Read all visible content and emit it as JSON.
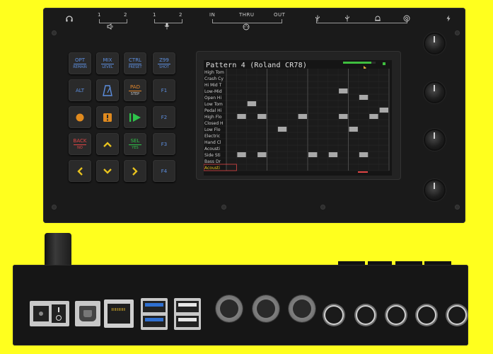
{
  "device": {
    "top_panel": {
      "labels": {
        "headphone_ch1": "1",
        "headphone_ch2": "2",
        "mic_ch1": "1",
        "mic_ch2": "2",
        "midi_in": "IN",
        "midi_thru": "THRU",
        "midi_out": "OUT"
      }
    },
    "keys": [
      {
        "id": "opt",
        "line1": "OPT",
        "line2": "REMAIN",
        "line1_color": "#5d8fe0",
        "line2_color": "#5d8fe0"
      },
      {
        "id": "mix",
        "line1": "MIX",
        "line2": "LEVEL",
        "line1_color": "#5d8fe0",
        "line2_color": "#5d8fe0"
      },
      {
        "id": "ctrl",
        "line1": "CTRL",
        "line2": "PRESET",
        "line1_color": "#5d8fe0",
        "line2_color": "#5d8fe0"
      },
      {
        "id": "zoom",
        "line1": "Z99",
        "line2": "SHOT",
        "line1_color": "#5d8fe0",
        "line2_color": "#5d8fe0"
      },
      {
        "id": "alt",
        "line1": "ALT",
        "line2": "",
        "line1_color": "#5d8fe0",
        "line2_color": "#5d8fe0"
      },
      {
        "id": "metronome",
        "line1": "",
        "line2": "",
        "line1_color": "#5d8fe0",
        "line2_color": "#5d8fe0"
      },
      {
        "id": "pad",
        "line1": "PAD",
        "line2": "STEP",
        "line1_color": "#e0862c",
        "line2_color": "#cccccc"
      },
      {
        "id": "f1",
        "line1": "F1",
        "line2": "",
        "line1_color": "#5d8fe0",
        "line2_color": "#5d8fe0"
      },
      {
        "id": "record",
        "line1": "",
        "line2": "",
        "line1_color": "#e08a1e",
        "line2_color": "#5d8fe0"
      },
      {
        "id": "stop",
        "line1": "",
        "line2": "",
        "line1_color": "#e08a1e",
        "line2_color": "#5d8fe0"
      },
      {
        "id": "play",
        "line1": "",
        "line2": "",
        "line1_color": "#2ec44a",
        "line2_color": "#5d8fe0"
      },
      {
        "id": "f2",
        "line1": "F2",
        "line2": "",
        "line1_color": "#5d8fe0",
        "line2_color": "#5d8fe0"
      },
      {
        "id": "back",
        "line1": "BACK",
        "line2": "NO",
        "line1_color": "#e04545",
        "line2_color": "#e04545"
      },
      {
        "id": "up",
        "line1": "",
        "line2": "",
        "line1_color": "#e8c21e",
        "line2_color": "#5d8fe0"
      },
      {
        "id": "sel",
        "line1": "SEL",
        "line2": "YES",
        "line1_color": "#2ec44a",
        "line2_color": "#2ec44a"
      },
      {
        "id": "f3",
        "line1": "F3",
        "line2": "",
        "line1_color": "#5d8fe0",
        "line2_color": "#5d8fe0"
      },
      {
        "id": "left",
        "line1": "",
        "line2": "",
        "line1_color": "#e8c21e",
        "line2_color": "#5d8fe0"
      },
      {
        "id": "down",
        "line1": "",
        "line2": "",
        "line1_color": "#e8c21e",
        "line2_color": "#5d8fe0"
      },
      {
        "id": "right",
        "line1": "",
        "line2": "",
        "line1_color": "#e8c21e",
        "line2_color": "#5d8fe0"
      },
      {
        "id": "f4",
        "line1": "F4",
        "line2": "",
        "line1_color": "#5d8fe0",
        "line2_color": "#5d8fe0"
      }
    ],
    "screen": {
      "title": "Pattern 4 (Roland CR78)",
      "tracks": [
        "High Tom",
        "Crash Cy",
        "Hi Mid T",
        "Low-Mid",
        "Open Hi",
        "Low Tom",
        "Pedal Hi",
        "High Flo",
        "Closed H",
        "Low Flo",
        "Electric",
        "Hand Cl",
        "Acousti",
        "Side Sti",
        "Bass Dr",
        "Acousti"
      ],
      "steps_total": 16,
      "notes": [
        {
          "row": 3,
          "step": 12
        },
        {
          "row": 4,
          "step": 14
        },
        {
          "row": 5,
          "step": 3
        },
        {
          "row": 6,
          "step": 16
        },
        {
          "row": 7,
          "step": 2
        },
        {
          "row": 7,
          "step": 4
        },
        {
          "row": 7,
          "step": 8
        },
        {
          "row": 7,
          "step": 12
        },
        {
          "row": 7,
          "step": 15
        },
        {
          "row": 9,
          "step": 6
        },
        {
          "row": 9,
          "step": 13
        },
        {
          "row": 13,
          "step": 2
        },
        {
          "row": 13,
          "step": 4
        },
        {
          "row": 13,
          "step": 9
        },
        {
          "row": 13,
          "step": 11
        },
        {
          "row": 13,
          "step": 14
        }
      ],
      "accent_color": "#3fbf3f",
      "note_color": "#a9a9a9"
    }
  }
}
